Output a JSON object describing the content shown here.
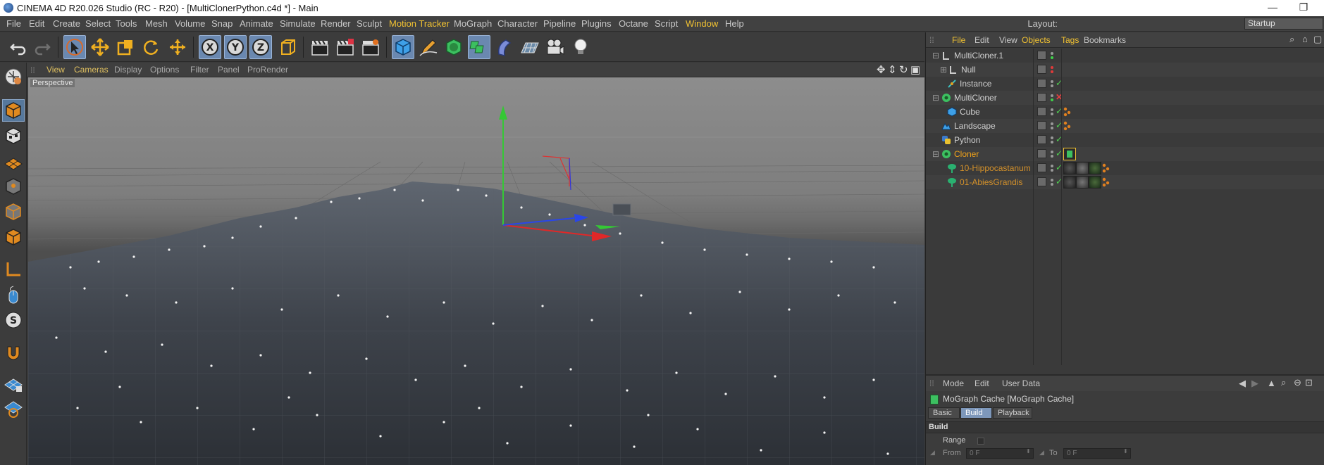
{
  "window": {
    "title": "CINEMA 4D R20.026 Studio (RC - R20) - [MultiClonerPython.c4d *] - Main",
    "minimize": "—",
    "restore": "❐"
  },
  "menubar": {
    "items": [
      "File",
      "Edit",
      "Create",
      "Select",
      "Tools",
      "Mesh",
      "Volume",
      "Snap",
      "Animate",
      "Simulate",
      "Render",
      "Sculpt",
      "Motion Tracker",
      "MoGraph",
      "Character",
      "Pipeline",
      "Plugins",
      "Octane",
      "Script",
      "Window",
      "Help"
    ],
    "highlighted": [
      "Motion Tracker",
      "Window"
    ],
    "layout_label": "Layout:",
    "layout_value": "Startup"
  },
  "toolbar": {
    "tools": [
      "undo",
      "redo",
      "live-selection",
      "move",
      "scale",
      "rotate",
      "last-tool",
      "x-axis",
      "y-axis",
      "z-axis",
      "coordinate-system",
      "render-view",
      "render-to-picture-viewer",
      "render-settings",
      "cube",
      "pen",
      "subdivision-surface",
      "array",
      "deformer",
      "floor",
      "camera",
      "light"
    ]
  },
  "left_tools": [
    "make-editable",
    "model-mode",
    "texture-mode",
    "workplane-mode",
    "points-mode",
    "edges-mode",
    "polygons-mode",
    "axis-mode",
    "tweak-mode",
    "snapping",
    "soloing",
    "locked-workplane",
    "planar-workplane"
  ],
  "viewport": {
    "menu": [
      "View",
      "Cameras",
      "Display",
      "Options",
      "Filter",
      "Panel",
      "ProRender"
    ],
    "highlighted": [
      "View",
      "Cameras"
    ],
    "camera_label": "Perspective"
  },
  "object_manager": {
    "menu": [
      "File",
      "Edit",
      "View",
      "Objects",
      "Tags",
      "Bookmarks"
    ],
    "highlighted": [
      "File",
      "Objects",
      "Tags"
    ],
    "objects": [
      {
        "name": "MultiCloner.1",
        "indent": 0,
        "icon": "null",
        "color": "#d0d0d0",
        "status": "dots-green-red"
      },
      {
        "name": "Null",
        "indent": 1,
        "icon": "null",
        "color": "#d0d0d0",
        "status": "dots-red"
      },
      {
        "name": "Instance",
        "indent": 2,
        "icon": "instance",
        "color": "#d0d0d0",
        "status": "check"
      },
      {
        "name": "MultiCloner",
        "indent": 0,
        "icon": "mograph",
        "color": "#d0d0d0",
        "status": "x"
      },
      {
        "name": "Cube",
        "indent": 1,
        "icon": "cube",
        "color": "#d0d0d0",
        "status": "check",
        "tag": "dots"
      },
      {
        "name": "Landscape",
        "indent": 0,
        "icon": "landscape",
        "color": "#d0d0d0",
        "status": "check",
        "tag": "dots"
      },
      {
        "name": "Python",
        "indent": 0,
        "icon": "python",
        "color": "#d0d0d0",
        "status": "check"
      },
      {
        "name": "Cloner",
        "indent": 0,
        "icon": "cloner",
        "color": "#f1a31a",
        "status": "check",
        "tag": "cache"
      },
      {
        "name": "10-Hippocastanum",
        "indent": 1,
        "icon": "tree",
        "color": "#d4912a",
        "status": "check",
        "tag": "textures"
      },
      {
        "name": "01-AbiesGrandis",
        "indent": 1,
        "icon": "tree",
        "color": "#d4912a",
        "status": "check",
        "tag": "textures"
      }
    ]
  },
  "attribute_manager": {
    "menu": [
      "Mode",
      "Edit",
      "User Data"
    ],
    "object_title": "MoGraph Cache [MoGraph Cache]",
    "tabs": [
      "Basic",
      "Build",
      "Playback"
    ],
    "active_tab": "Build",
    "section": "Build",
    "range_label": "Range",
    "from_label": "From",
    "from_value": "0 F",
    "to_label": "To",
    "to_value": "0 F"
  }
}
